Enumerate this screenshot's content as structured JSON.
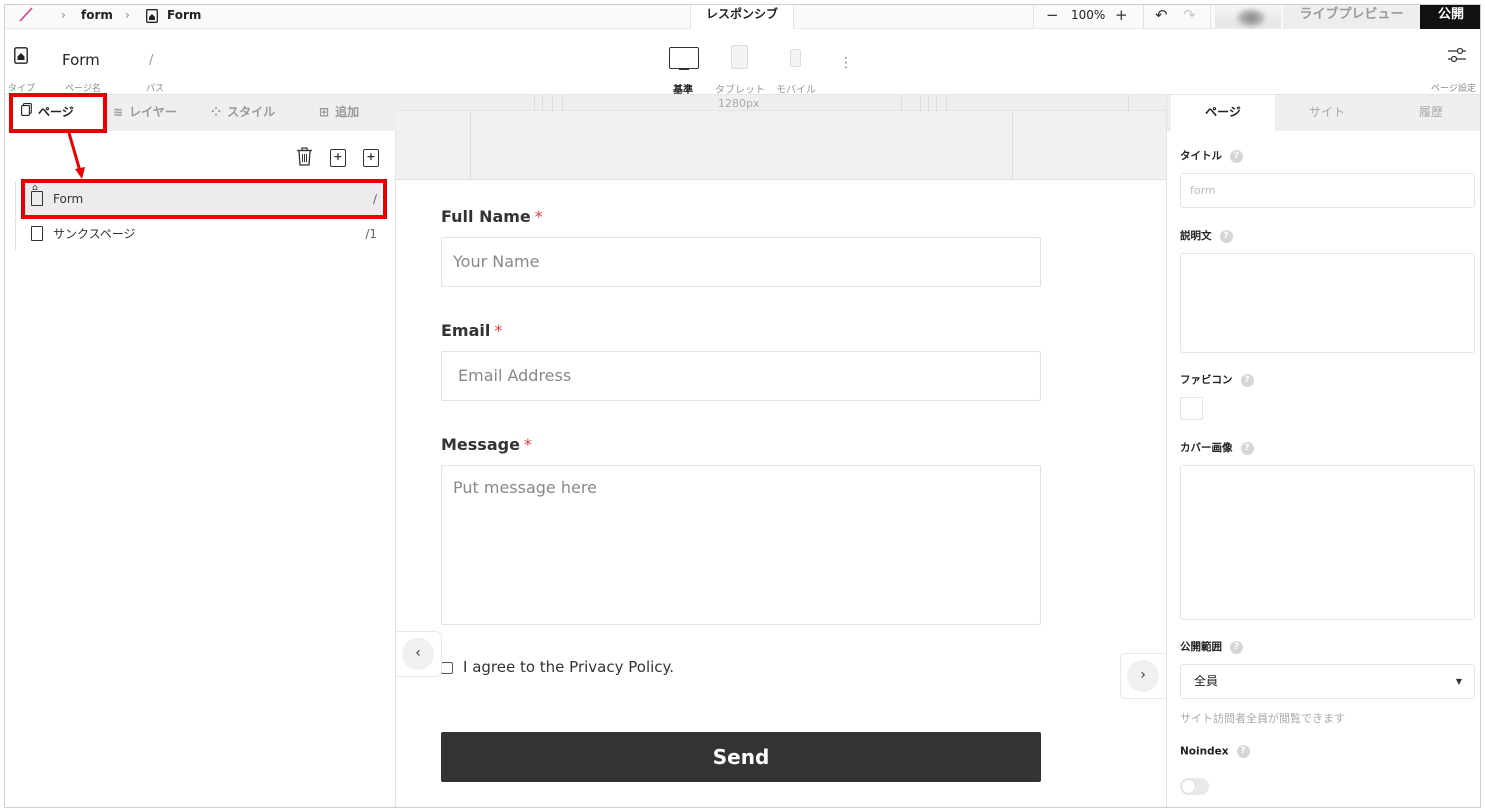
{
  "topbar": {
    "crumb1": "form",
    "crumb2": "Form",
    "responsive_tab": "レスポンシブ",
    "zoom": "100%",
    "live_preview": "ライブプレビュー",
    "publish": "公開"
  },
  "subbar": {
    "type_label": "タイプ",
    "page_name": "Form",
    "page_name_label": "ページ名",
    "path": "/",
    "path_label": "パス",
    "devices": [
      {
        "label": "基準"
      },
      {
        "label": "タブレット"
      },
      {
        "label": "モバイル"
      }
    ],
    "settings_label": "ページ設定"
  },
  "leftpanel": {
    "tabs": [
      {
        "label": "ページ"
      },
      {
        "label": "レイヤー"
      },
      {
        "label": "スタイル"
      },
      {
        "label": "追加"
      }
    ],
    "pages": [
      {
        "name": "Form",
        "path": "/"
      },
      {
        "name": "サンクスページ",
        "path": "/1"
      }
    ]
  },
  "canvas": {
    "ruler_label": "1280px",
    "form": {
      "name_label": "Full Name",
      "name_placeholder": "Your Name",
      "email_label": "Email",
      "email_placeholder": "Email Address",
      "message_label": "Message",
      "message_placeholder": "Put message here",
      "required_mark": "*",
      "agree_label": "I agree to the Privacy Policy.",
      "send_label": "Send"
    }
  },
  "rightpanel": {
    "tabs": [
      {
        "label": "ページ"
      },
      {
        "label": "サイト"
      },
      {
        "label": "履歴"
      }
    ],
    "title_label": "タイトル",
    "title_placeholder": "form",
    "desc_label": "説明文",
    "favicon_label": "ファビコン",
    "cover_label": "カバー画像",
    "scope_label": "公開範囲",
    "scope_value": "全員",
    "scope_hint": "サイト訪問者全員が閲覧できます",
    "noindex_label": "Noindex",
    "help_glyph": "?"
  },
  "colors": {
    "annotation_red": "#ea0000",
    "brand_pink": "#d63b8a",
    "send_bg": "#333333",
    "required": "#e03b3b"
  }
}
